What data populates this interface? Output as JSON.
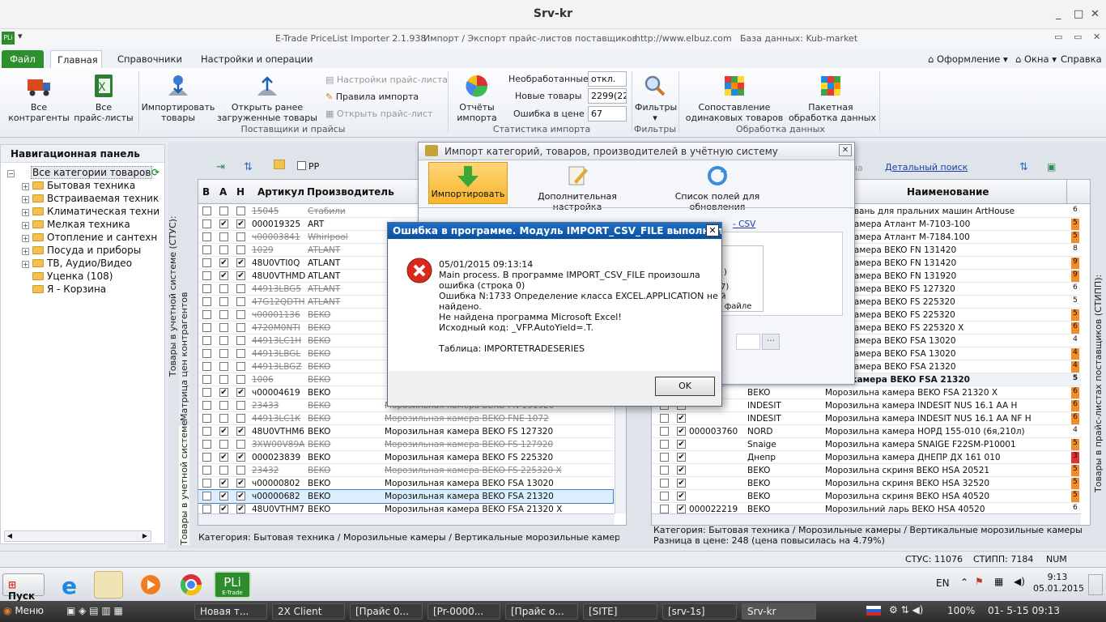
{
  "window": {
    "title": "Srv-kr"
  },
  "infobar": {
    "app": "E-Trade PriceList Importer 2.1.938",
    "desc": "Импорт / Экспорт прайс-листов поставщиков",
    "url": "http://www.elbuz.com",
    "db": "База данных: Kub-market"
  },
  "tabs": {
    "file": "Файл",
    "main": "Главная",
    "refs": "Справочники",
    "settings": "Настройки и операции",
    "design": "Оформление",
    "windows": "Окна",
    "help": "Справка"
  },
  "ribbon": {
    "all_contractors": "Все\nконтрагенты",
    "all_pricelists": "Все\nпрайс-листы",
    "import_goods": "Импортировать\nтовары",
    "open_loaded": "Открыть ранее\nзагруженные товары",
    "pl_settings": "Настройки прайс-листа",
    "import_rules": "Правила импорта",
    "open_pl": "Открыть прайс-лист",
    "group_suppliers": "Поставщики и прайсы",
    "reports": "Отчёты\nимпорта",
    "unprocessed_label": "Необработанные",
    "unprocessed_value": "откл.",
    "new_goods_label": "Новые товары",
    "new_goods_value": "2299(229",
    "price_error_label": "Ошибка в цене",
    "price_error_value": "67",
    "group_stats": "Статистика импорта",
    "filters": "Фильтры",
    "group_filters": "Фильтры",
    "match": "Сопоставление\nодинаковых товаров",
    "batch": "Пакетная\nобработка данных",
    "group_processing": "Обработка данных"
  },
  "nav": {
    "title": "Навигационная панель",
    "items": [
      "Все категории товаров",
      "Бытовая техника",
      "Встраиваемая техник",
      "Климатическая техни",
      "Мелкая техника",
      "Отопление и сантехн",
      "Посуда и приборы",
      "ТВ, Аудио/Видео",
      "Уценка (108)",
      "Я - Корзина"
    ]
  },
  "left_tabs": {
    "status": "Товары в учетной системе (СТУС):",
    "matrix": "Матрица цен контрагентов",
    "goods_acc": "Товары в учетной системе"
  },
  "right_tab": "Товары в прайс-листах поставщиков (СТИПП):",
  "left_grid": {
    "pp": "PP",
    "headers": [
      "В",
      "А",
      "Н",
      "Артикул",
      "Производитель"
    ],
    "rows": [
      {
        "a": "15045",
        "m": "Стабили",
        "n": "",
        "ck": [
          0,
          0,
          0
        ],
        "del": true
      },
      {
        "a": "000019325",
        "m": "ART",
        "n": "",
        "ck": [
          0,
          1,
          1
        ],
        "del": false
      },
      {
        "a": "ч00003841",
        "m": "Whirlpool",
        "n": "",
        "ck": [
          0,
          0,
          0
        ],
        "del": true
      },
      {
        "a": "1029",
        "m": "ATLANT",
        "n": "",
        "ck": [
          0,
          0,
          0
        ],
        "del": true
      },
      {
        "a": "48U0VTI0Q",
        "m": "ATLANT",
        "n": "",
        "ck": [
          0,
          1,
          1
        ],
        "del": false
      },
      {
        "a": "48U0VTHMD",
        "m": "ATLANT",
        "n": "",
        "ck": [
          0,
          1,
          1
        ],
        "del": false
      },
      {
        "a": "44913LBG5",
        "m": "ATLANT",
        "n": "",
        "ck": [
          0,
          0,
          0
        ],
        "del": true
      },
      {
        "a": "47G12QDTH",
        "m": "ATLANT",
        "n": "",
        "ck": [
          0,
          0,
          0
        ],
        "del": true
      },
      {
        "a": "ч00001136",
        "m": "BEKO",
        "n": "",
        "ck": [
          0,
          0,
          0
        ],
        "del": true
      },
      {
        "a": "4720M0NTI",
        "m": "BEKO",
        "n": "",
        "ck": [
          0,
          0,
          0
        ],
        "del": true
      },
      {
        "a": "44913LC1H",
        "m": "BEKO",
        "n": "",
        "ck": [
          0,
          0,
          0
        ],
        "del": true
      },
      {
        "a": "44913LBGL",
        "m": "BEKO",
        "n": "",
        "ck": [
          0,
          0,
          0
        ],
        "del": true
      },
      {
        "a": "44913LBGZ",
        "m": "BEKO",
        "n": "",
        "ck": [
          0,
          0,
          0
        ],
        "del": true
      },
      {
        "a": "1006",
        "m": "BEKO",
        "n": "",
        "ck": [
          0,
          0,
          0
        ],
        "del": true
      },
      {
        "a": "ч00004619",
        "m": "BEKO",
        "n": "",
        "ck": [
          0,
          1,
          1
        ],
        "del": false
      },
      {
        "a": "23433",
        "m": "BEKO",
        "n": "Морозильная камера BEKO FN 131920",
        "ck": [
          0,
          0,
          0
        ],
        "del": true
      },
      {
        "a": "44913LC1K",
        "m": "BEKO",
        "n": "Морозильная камера BEKO FNE 1072",
        "ck": [
          0,
          0,
          0
        ],
        "del": true
      },
      {
        "a": "48U0VTHM6",
        "m": "BEKO",
        "n": "Морозильная камера BEKO FS 127320",
        "ck": [
          0,
          1,
          1
        ],
        "del": false
      },
      {
        "a": "3XW00V89A",
        "m": "BEKO",
        "n": "Морозильная камера BEKO FS 127920",
        "ck": [
          0,
          0,
          0
        ],
        "del": true
      },
      {
        "a": "000023839",
        "m": "BEKO",
        "n": "Морозильная камера BEKO FS 225320",
        "ck": [
          0,
          1,
          1
        ],
        "del": false
      },
      {
        "a": "23432",
        "m": "BEKO",
        "n": "Морозильная камера BEKO FS 225320 X",
        "ck": [
          0,
          0,
          0
        ],
        "del": true
      },
      {
        "a": "ч00000802",
        "m": "BEKO",
        "n": "Морозильная камера BEKO FSA 13020",
        "ck": [
          0,
          1,
          1
        ],
        "del": false
      },
      {
        "a": "ч00000682",
        "m": "BEKO",
        "n": "Морозильная камера BEKO FSA 21320",
        "ck": [
          0,
          1,
          1
        ],
        "del": false,
        "sel": true
      },
      {
        "a": "48U0VTHM7",
        "m": "BEKO",
        "n": "Морозильная камера BEKO FSA 21320 X",
        "ck": [
          0,
          1,
          1
        ],
        "del": false
      }
    ],
    "category": "Категория: Бытовая техника / Морозильные камеры / Вертикальные морозильные камеры"
  },
  "right_grid": {
    "detail_search": "Детальный поиск",
    "tail": "ена",
    "header": "Наименование",
    "rows": [
      {
        "a": "",
        "m": "",
        "n": "ч коливань для пральних машин ArtHouse",
        "ind": "6",
        "c": ""
      },
      {
        "a": "",
        "m": "",
        "n": "льна камера Атлант М-7103-100",
        "ind": "5",
        "c": "#f28c28"
      },
      {
        "a": "",
        "m": "",
        "n": "льна камера Атлант М-7184.100",
        "ind": "5",
        "c": "#f28c28"
      },
      {
        "a": "",
        "m": "",
        "n": "льна камера BEKO FN 131420",
        "ind": "8",
        "c": ""
      },
      {
        "a": "",
        "m": "",
        "n": "льна камера BEKO FN 131420",
        "ind": "9",
        "c": "#f28c28"
      },
      {
        "a": "",
        "m": "",
        "n": "льна камера BEKO FN 131920",
        "ind": "9",
        "c": "#f28c28"
      },
      {
        "a": "",
        "m": "",
        "n": "льна камера BEKO FS 127320",
        "ind": "6",
        "c": ""
      },
      {
        "a": "",
        "m": "",
        "n": "льна камера BEKO FS 225320",
        "ind": "5",
        "c": ""
      },
      {
        "a": "",
        "m": "",
        "n": "льна камера BEKO FS 225320",
        "ind": "5",
        "c": "#f28c28"
      },
      {
        "a": "",
        "m": "",
        "n": "льна камера BEKO FS 225320 X",
        "ind": "6",
        "c": "#f28c28"
      },
      {
        "a": "",
        "m": "",
        "n": "льна камера BEKO FSA 13020",
        "ind": "4",
        "c": ""
      },
      {
        "a": "",
        "m": "",
        "n": "льна камера BEKO FSA  13020",
        "ind": "4",
        "c": "#f28c28"
      },
      {
        "a": "",
        "m": "",
        "n": "льна камера BEKO FSA 21320",
        "ind": "4",
        "c": "#f28c28"
      },
      {
        "a": "",
        "m": "",
        "n": "льна камера BEKO FSA 21320",
        "ind": "5",
        "c": "",
        "bold": true
      },
      {
        "a": "",
        "m": "BEKO",
        "n": "Морозильна камера BEKO FSA 21320 X",
        "ind": "6",
        "c": "#f28c28"
      },
      {
        "a": "",
        "m": "INDESIT",
        "n": "Морозильна камера INDESIT NUS  16.1 AA H",
        "ind": "6",
        "c": "#f28c28"
      },
      {
        "a": "",
        "m": "INDESIT",
        "n": "Морозильна камера INDESIT NUS  16.1 AA NF H",
        "ind": "6",
        "c": "#f28c28"
      },
      {
        "a": "000003760",
        "m": "NORD",
        "n": "Морозильна камера НОРД 155-010 (6я,210л)",
        "ind": "4",
        "c": ""
      },
      {
        "a": "",
        "m": "Snaige",
        "n": "Морозильна камера SNAIGE F22SM-P10001",
        "ind": "5",
        "c": "#f28c28"
      },
      {
        "a": "",
        "m": "Днепр",
        "n": "Морозильна камера ДНЕПР ДХ 161 010",
        "ind": "3",
        "c": "#e03030"
      },
      {
        "a": "",
        "m": "BEKO",
        "n": "Морозильна скриня BEKO HSA 20521",
        "ind": "5",
        "c": "#f28c28"
      },
      {
        "a": "",
        "m": "BEKO",
        "n": "Морозильна скриня BEKO HSA 32520",
        "ind": "5",
        "c": "#f28c28"
      },
      {
        "a": "",
        "m": "BEKO",
        "n": "Морозильна скриня BEKO HSA 40520",
        "ind": "5",
        "c": "#f28c28"
      },
      {
        "a": "000022219",
        "m": "BEKO",
        "n": "Морозильний ларь BEKO HSA 40520",
        "ind": "6",
        "c": ""
      }
    ],
    "category": "Категория: Бытовая техника / Морозильные камеры / Вертикальные морозильные камеры",
    "price_diff": "Разница в цене: 248  (цена повысилась на 4.79%)"
  },
  "import_window": {
    "title": "Импорт категорий, товаров, производителей в учётную систему",
    "btn_import": "Импортировать",
    "btn_extra": "Дополнительная настройка",
    "btn_fields": "Список полей для обновления",
    "frag_csv": "- CSV",
    "frag_1": ")",
    "frag_2": "й",
    "frag_3": "7)",
    "frag_4": "м файле",
    "frag_dots": "..."
  },
  "error": {
    "title": "Ошибка в программе. Модуль IMPORT_CSV_FILE выполнил недо...",
    "message": "05/01/2015 09:13:14\nMain process. В программе IMPORT_CSV_FILE произошла\nошибка (строка 0)\nОшибка N:1733 Определение класса EXCEL.APPLICATION не\nнайдено.\nНе найдена программа Microsoft Excel!\nИсходный код: _VFP.AutoYield=.T.\n\nТаблица: IMPORTETRADESERIES",
    "ok": "OK"
  },
  "status": {
    "stus": "СТУС: 11076",
    "stipp": "СТИПП: 7184",
    "num": "NUM"
  },
  "taskbar": {
    "start": "Пуск",
    "lang": "EN",
    "time": "9:13",
    "date": "05.01.2015",
    "pli_label": "E-Trade"
  },
  "taskbar2": {
    "menu": "Меню",
    "items": [
      "Новая т...",
      "2X Client",
      "[Прайс 0...",
      "[Pr-0000...",
      "[Прайс о...",
      "[SITE]",
      "[srv-1s]",
      "Srv-kr"
    ],
    "battery": "100%",
    "clock": "01- 5-15 09:13"
  }
}
